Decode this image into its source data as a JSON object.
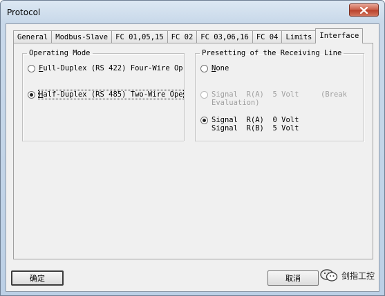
{
  "window": {
    "title": "Protocol"
  },
  "tabs": [
    {
      "label": "General"
    },
    {
      "label": "Modbus-Slave"
    },
    {
      "label": "FC 01,05,15"
    },
    {
      "label": "FC 02"
    },
    {
      "label": "FC 03,06,16"
    },
    {
      "label": "FC 04"
    },
    {
      "label": "Limits"
    },
    {
      "label": "Interface",
      "active": true
    }
  ],
  "operating_mode": {
    "legend": "Operating Mode",
    "full_duplex": {
      "underlined": "F",
      "label": "ull-Duplex (RS 422) Four-Wire Op",
      "checked": false
    },
    "half_duplex": {
      "underlined": "H",
      "label": "alf-Duplex (RS 485) Two-Wire Ope",
      "checked": true
    }
  },
  "presetting": {
    "legend": "Presetting of the Receiving Line",
    "none": {
      "underlined": "N",
      "label": "one",
      "checked": false
    },
    "signal_5v": {
      "line1": "Signal  R(A)  5 Volt     (Break",
      "line2": "Evaluation)",
      "checked": false,
      "disabled": true
    },
    "signal_0v": {
      "line1": "Signal  R(A)  0 Volt",
      "line2": "Signal  R(B)  5 Volt",
      "checked": true
    }
  },
  "buttons": {
    "ok": "确定",
    "cancel": "取消"
  },
  "watermark": {
    "text": "剑指工控"
  }
}
